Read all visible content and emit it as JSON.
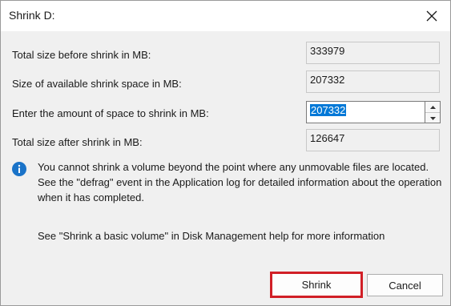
{
  "window": {
    "title": "Shrink D:",
    "close_icon": "close-icon"
  },
  "fields": {
    "total_before": {
      "label": "Total size before shrink in MB:",
      "value": "333979"
    },
    "available": {
      "label": "Size of available shrink space in MB:",
      "value": "207332"
    },
    "amount": {
      "label": "Enter the amount of space to shrink in MB:",
      "value": "207332"
    },
    "total_after": {
      "label": "Total size after shrink in MB:",
      "value": "126647"
    }
  },
  "info": {
    "icon": "info-icon",
    "text": "You cannot shrink a volume beyond the point where any unmovable files are located. See the \"defrag\" event in the Application log for detailed information about the operation when it has completed."
  },
  "help_text": "See \"Shrink a basic volume\" in Disk Management help for more information",
  "buttons": {
    "shrink": "Shrink",
    "cancel": "Cancel"
  },
  "colors": {
    "highlight": "#0078d7",
    "shrink_outline": "#d11f26",
    "info_icon": "#1a73c8"
  }
}
